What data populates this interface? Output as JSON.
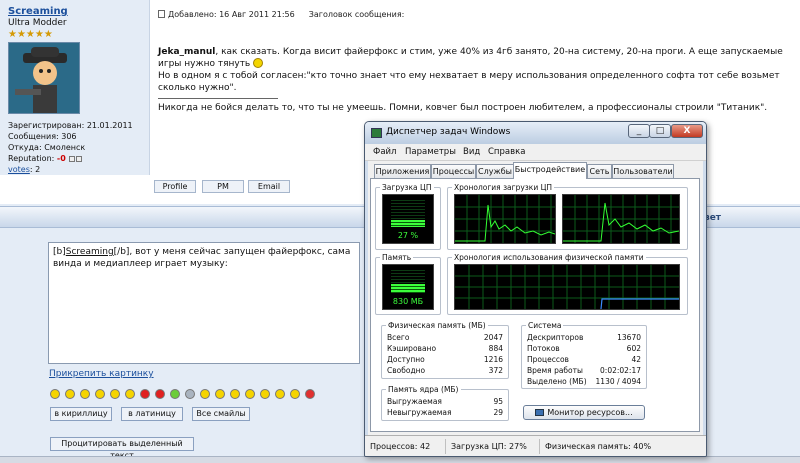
{
  "post": {
    "author": "Screaming",
    "rank": "Ultra Modder",
    "stars": "★★★★★",
    "registered": "Зарегистрирован: 21.01.2011",
    "messages": "Сообщения: 306",
    "from": "Откуда: Смоленск",
    "reputation_label": "Reputation:",
    "reputation_value": "-0",
    "votes_label": "votes",
    "votes_value": ": 2",
    "added": "Добавлено: 16 Авг 2011 21:56",
    "subject_label": "Заголовок сообщения:",
    "quote_author": "Jeka_manul",
    "body_line1": ", как сказать. Когда висит файерфокс и стим, уже 40% из 4гб занято, 20-на систему, 20-на проги. А еще запускаемые игры нужно тянуть",
    "body_line2": "Но в одном я с тобой согласен:\"кто точно знает что ему нехватает в меру использования определенного софта тот себе возьмет сколько нужно\".",
    "signature": "Никогда не бойся делать то, что ты не умеешь. Помни, ковчег был построен любителем, а профессионалы строили \"Титаник\".",
    "buttons": {
      "profile": "Profile",
      "pm": "PM",
      "email": "Email"
    }
  },
  "reply": {
    "band_tail": "вет",
    "text_prefix": "[b]",
    "text_name": "Screaming",
    "text_suffix": "[/b], вот у меня сейчас запущен файерфокс, сама винда и медиаплеер играет музыку:",
    "attach_link": "Прикрепить картинку",
    "translit_cyr": "в кириллицу",
    "translit_lat": "в латиницу",
    "all_smileys": "Все смайлы",
    "quote_selected": "Процитировать выделенный текст"
  },
  "taskmgr": {
    "title": "Диспетчер задач Windows",
    "window_buttons": {
      "minimize": "_",
      "maximize": "□",
      "close": "X"
    },
    "menu": [
      "Файл",
      "Параметры",
      "Вид",
      "Справка"
    ],
    "tabs": [
      "Приложения",
      "Процессы",
      "Службы",
      "Быстродействие",
      "Сеть",
      "Пользователи"
    ],
    "active_tab": "Быстродействие",
    "cpu_group": "Загрузка ЦП",
    "cpu_value": "27 %",
    "cpu_fraction": 0.27,
    "cpu_history_group": "Хронология загрузки ЦП",
    "mem_group": "Память",
    "mem_value": "830 МБ",
    "mem_fraction": 0.4,
    "mem_history_group": "Хронология использования физической памяти",
    "phys_group": "Физическая память (МБ)",
    "phys": [
      {
        "k": "Всего",
        "v": "2047"
      },
      {
        "k": "Кэшировано",
        "v": "884"
      },
      {
        "k": "Доступно",
        "v": "1216"
      },
      {
        "k": "Свободно",
        "v": "372"
      }
    ],
    "kernel_group": "Память ядра (МБ)",
    "kernel": [
      {
        "k": "Выгружаемая",
        "v": "95"
      },
      {
        "k": "Невыгружаемая",
        "v": "29"
      }
    ],
    "system_group": "Система",
    "system": [
      {
        "k": "Дескрипторов",
        "v": "13670"
      },
      {
        "k": "Потоков",
        "v": "602"
      },
      {
        "k": "Процессов",
        "v": "42"
      },
      {
        "k": "Время работы",
        "v": "0:02:02:17"
      },
      {
        "k": "Выделено (МБ)",
        "v": "1130 / 4094"
      }
    ],
    "monitor_button": "Монитор ресурсов...",
    "status": {
      "processes": "Процессов: 42",
      "cpu": "Загрузка ЦП: 27%",
      "memory": "Физическая память: 40%"
    },
    "colors": {
      "graph_line": "#33ff33",
      "graph_grid": "#0b5a1a",
      "mem_line": "#3a8cff"
    }
  }
}
